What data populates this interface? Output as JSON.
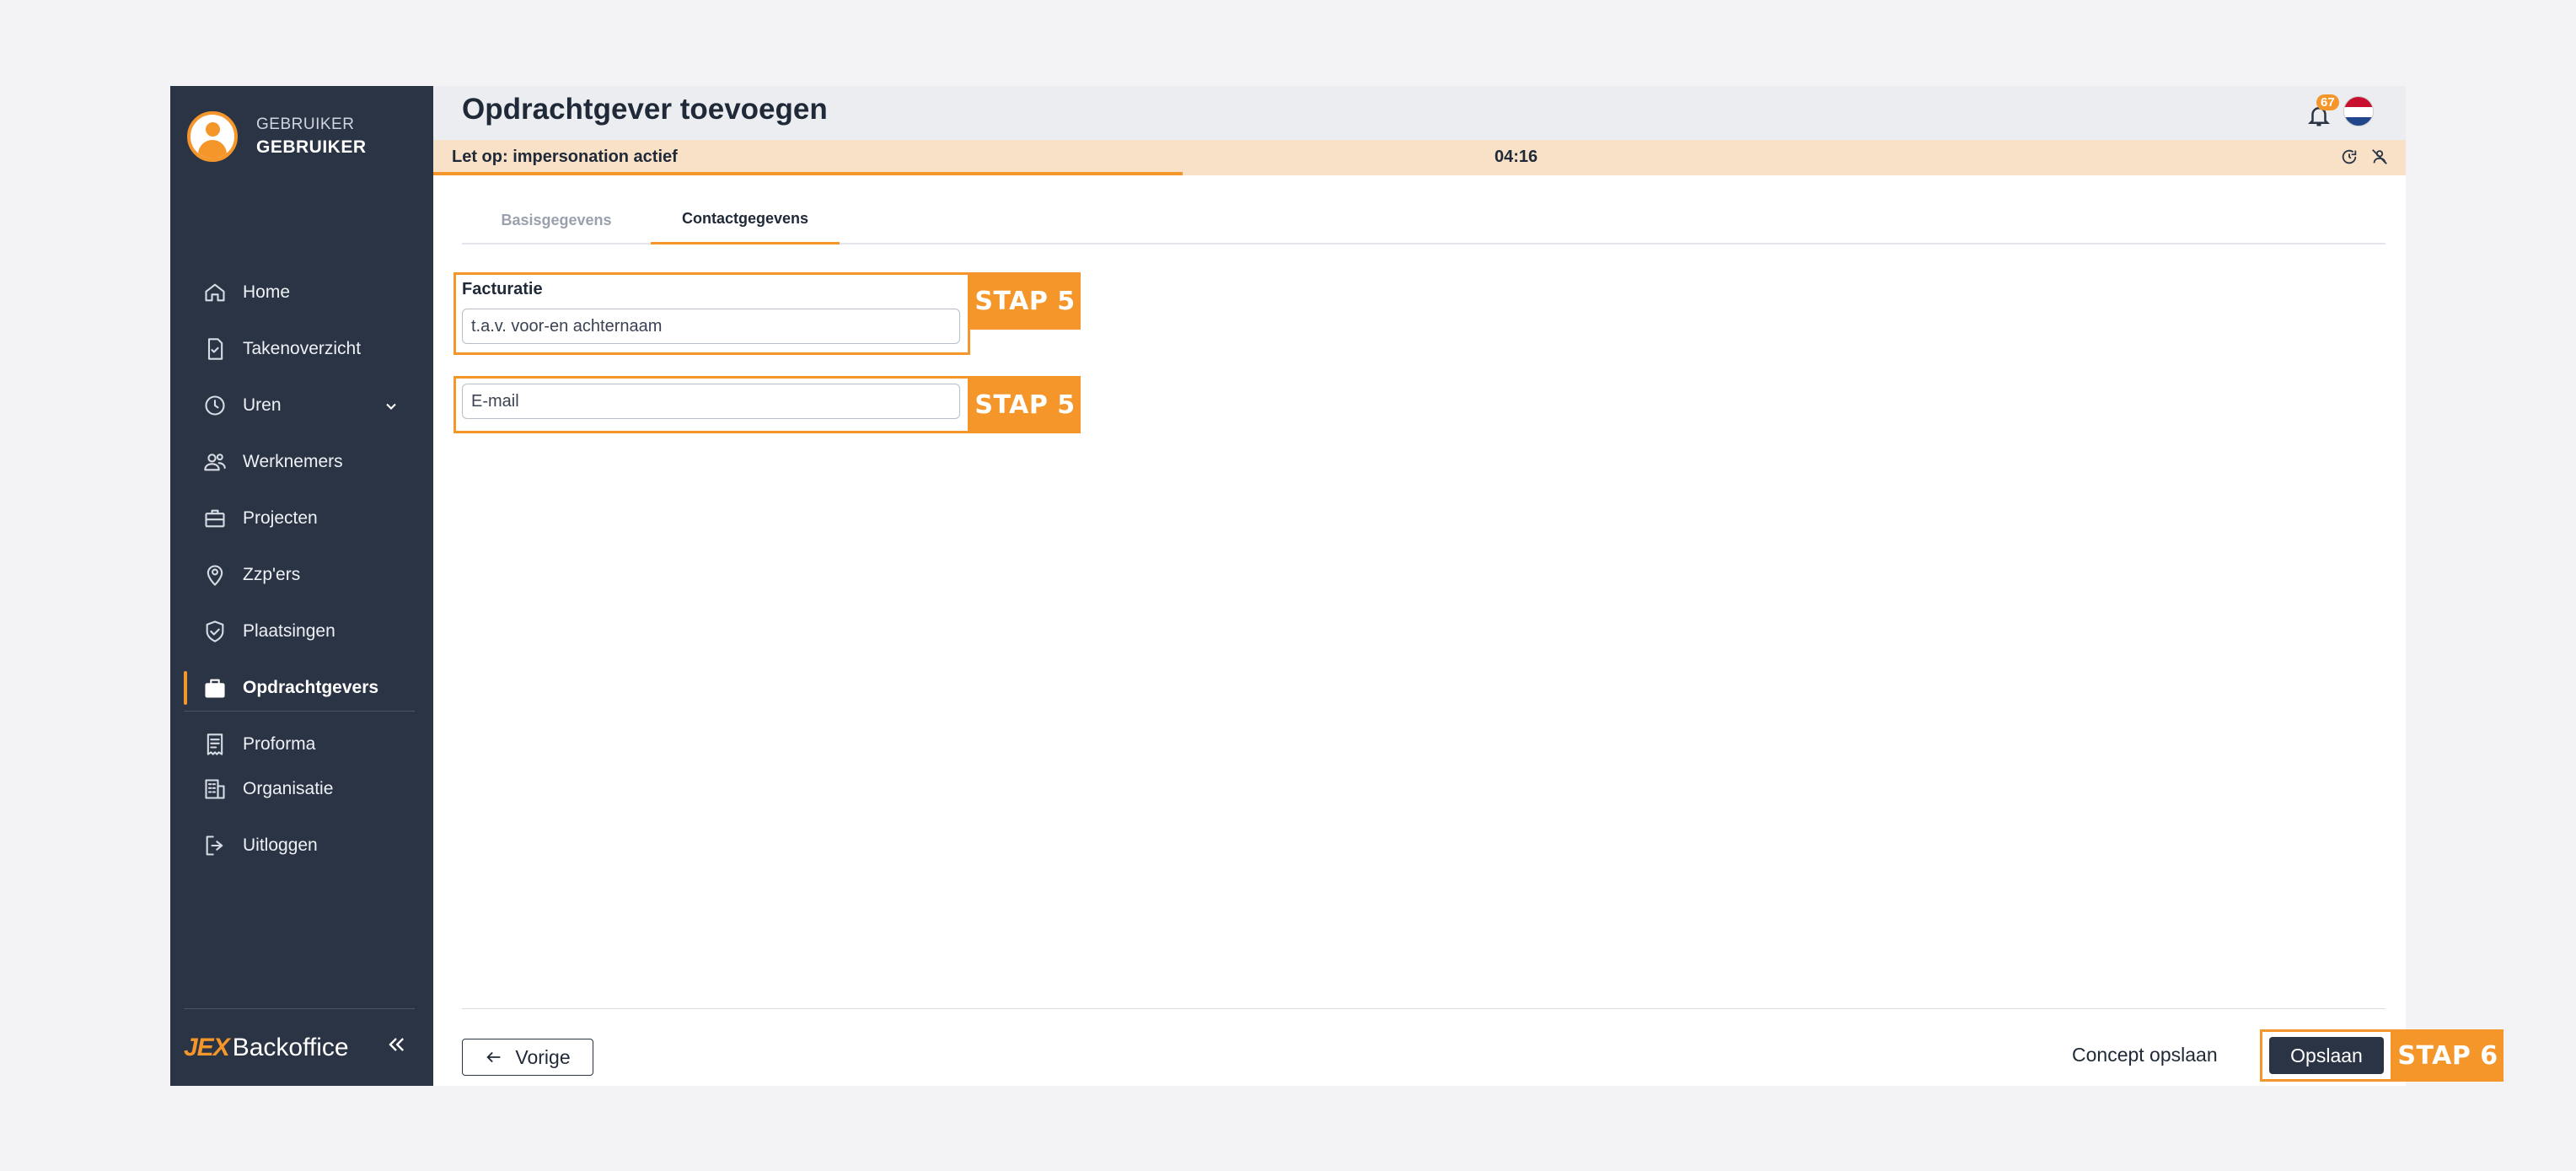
{
  "user": {
    "role": "GEBRUIKER",
    "name": "GEBRUIKER"
  },
  "nav": [
    {
      "label": "Home",
      "icon": "home-icon"
    },
    {
      "label": "Takenoverzicht",
      "icon": "task-check-icon"
    },
    {
      "label": "Uren",
      "icon": "clock-icon",
      "expandable": true
    },
    {
      "label": "Werknemers",
      "icon": "employees-icon"
    },
    {
      "label": "Projecten",
      "icon": "briefcase-icon"
    },
    {
      "label": "Zzp'ers",
      "icon": "location-person-icon"
    },
    {
      "label": "Plaatsingen",
      "icon": "shield-check-icon"
    },
    {
      "label": "Opdrachtgevers",
      "icon": "clients-briefcase-icon",
      "active": true
    },
    {
      "label": "Proforma",
      "icon": "invoice-icon"
    }
  ],
  "nav_secondary": [
    {
      "label": "Organisatie",
      "icon": "building-icon"
    },
    {
      "label": "Uitloggen",
      "icon": "logout-icon"
    }
  ],
  "brand": {
    "jex": "JEX",
    "name": "Backoffice"
  },
  "header": {
    "title": "Opdrachtgever toevoegen",
    "notification_count": "67",
    "language": "nl-flag"
  },
  "impersonation": {
    "message": "Let op: impersonation actief",
    "timer": "04:16",
    "progress": 0.38
  },
  "tabs": [
    {
      "label": "Basisgegevens",
      "active": false
    },
    {
      "label": "Contactgegevens",
      "active": true
    }
  ],
  "form": {
    "section_label": "Facturatie",
    "tav_placeholder": "t.a.v. voor-en achternaam",
    "email_placeholder": "E-mail",
    "stap5_label": "STAP 5"
  },
  "footer": {
    "prev_label": "Vorige",
    "concept_label": "Concept opslaan",
    "save_label": "Opslaan",
    "stap6_label": "STAP 6"
  },
  "colors": {
    "accent": "#f4962a",
    "sidebar": "#2b3444",
    "impersonation_bg": "#f8e1c7"
  }
}
